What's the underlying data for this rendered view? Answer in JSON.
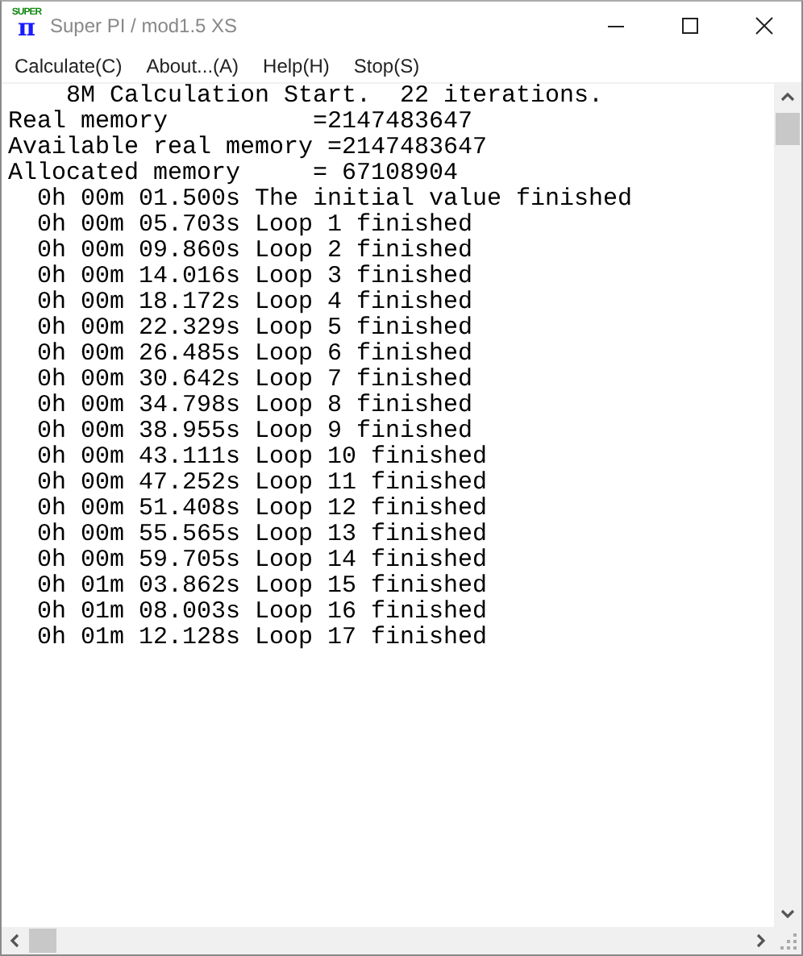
{
  "window": {
    "title": "Super PI / mod1.5 XS",
    "logo": {
      "top": "SUPER",
      "symbol": "π"
    }
  },
  "menu": [
    {
      "label": "Calculate(C)"
    },
    {
      "label": "About...(A)"
    },
    {
      "label": "Help(H)"
    },
    {
      "label": "Stop(S)"
    }
  ],
  "output": {
    "lines": [
      "    8M Calculation Start.  22 iterations.",
      "Real memory          =2147483647",
      "Available real memory =2147483647",
      "Allocated memory     = 67108904",
      "  0h 00m 01.500s The initial value finished",
      "  0h 00m 05.703s Loop 1 finished",
      "  0h 00m 09.860s Loop 2 finished",
      "  0h 00m 14.016s Loop 3 finished",
      "  0h 00m 18.172s Loop 4 finished",
      "  0h 00m 22.329s Loop 5 finished",
      "  0h 00m 26.485s Loop 6 finished",
      "  0h 00m 30.642s Loop 7 finished",
      "  0h 00m 34.798s Loop 8 finished",
      "  0h 00m 38.955s Loop 9 finished",
      "  0h 00m 43.111s Loop 10 finished",
      "  0h 00m 47.252s Loop 11 finished",
      "  0h 00m 51.408s Loop 12 finished",
      "  0h 00m 55.565s Loop 13 finished",
      "  0h 00m 59.705s Loop 14 finished",
      "  0h 01m 03.862s Loop 15 finished",
      "  0h 01m 08.003s Loop 16 finished",
      "  0h 01m 12.128s Loop 17 finished"
    ]
  }
}
